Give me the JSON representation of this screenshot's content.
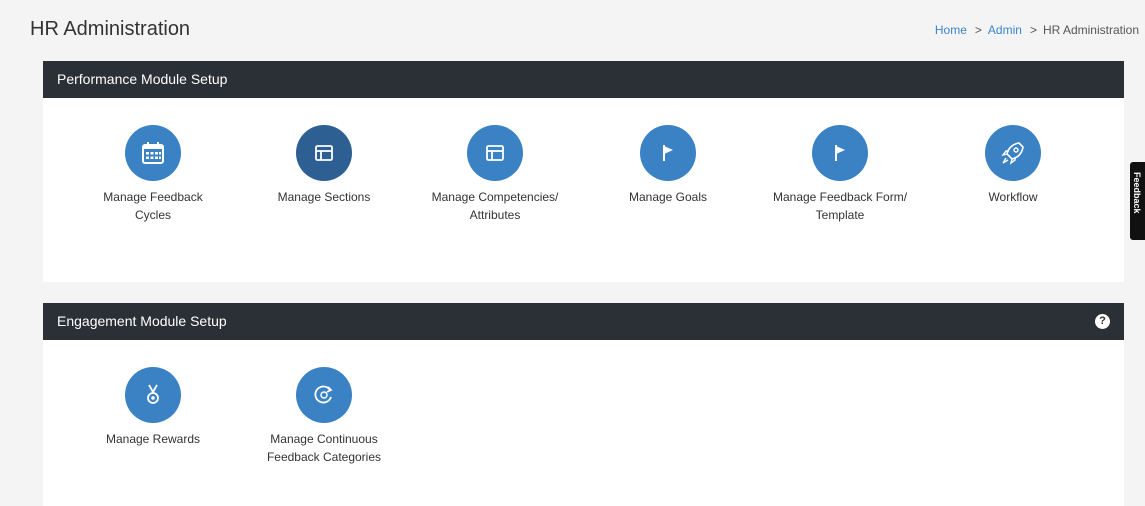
{
  "header": {
    "title": "HR Administration",
    "breadcrumb": {
      "home": "Home",
      "admin": "Admin",
      "current": "HR Administration",
      "separator": ">"
    }
  },
  "performance": {
    "title": "Performance Module Setup",
    "items": [
      {
        "label": "Manage Feedback Cycles",
        "icon": "calendar-icon"
      },
      {
        "label": "Manage Sections",
        "icon": "layout-icon"
      },
      {
        "label": "Manage Competencies/ Attributes",
        "icon": "layout-icon"
      },
      {
        "label": "Manage Goals",
        "icon": "flag-icon"
      },
      {
        "label": "Manage Feedback Form/ Template",
        "icon": "flag-icon"
      },
      {
        "label": "Workflow",
        "icon": "rocket-icon"
      }
    ]
  },
  "engagement": {
    "title": "Engagement Module Setup",
    "help": "?",
    "items": [
      {
        "label": "Manage Rewards",
        "icon": "medal-icon"
      },
      {
        "label": "Manage Continuous Feedback Categories",
        "icon": "refresh-icon"
      }
    ]
  },
  "side_tab": {
    "label": "Feedback"
  },
  "colors": {
    "accent": "#3b82c4",
    "accent_dark": "#2d5f93",
    "header_bg": "#2b2f36"
  }
}
